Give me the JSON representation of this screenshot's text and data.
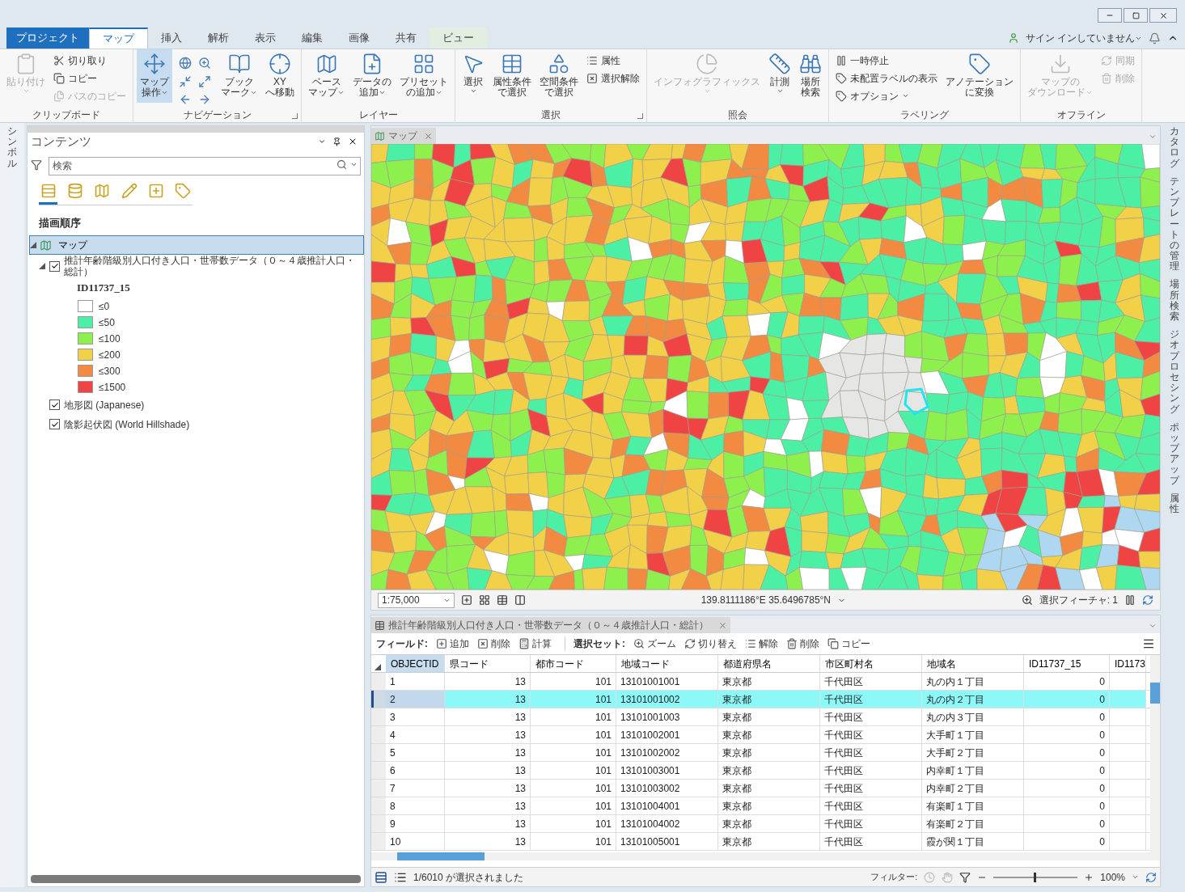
{
  "ribbon_tabs": [
    {
      "label": "プロジェクト",
      "kind": "file",
      "selected": false
    },
    {
      "label": "マップ",
      "kind": "normal",
      "selected": true
    },
    {
      "label": "挿入",
      "kind": "normal",
      "selected": false
    },
    {
      "label": "解析",
      "kind": "normal",
      "selected": false
    },
    {
      "label": "表示",
      "kind": "normal",
      "selected": false
    },
    {
      "label": "編集",
      "kind": "normal",
      "selected": false
    },
    {
      "label": "画像",
      "kind": "normal",
      "selected": false
    },
    {
      "label": "共有",
      "kind": "normal",
      "selected": false
    },
    {
      "label": "ビュー",
      "kind": "contextual",
      "selected": false
    }
  ],
  "account": {
    "label": "サイン インしていません"
  },
  "ribbon_groups": [
    {
      "title": "クリップボード",
      "launcher": false,
      "items": [
        {
          "kind": "large",
          "lines": [
            "貼り付け"
          ],
          "disabled": true,
          "menu": true
        },
        {
          "kind": "stack",
          "entries": [
            {
              "label": "切り取り",
              "disabled": false,
              "menu": false
            },
            {
              "label": "コピー",
              "disabled": false,
              "menu": false
            },
            {
              "label": "パスのコピー",
              "disabled": true,
              "menu": false
            }
          ]
        }
      ]
    },
    {
      "title": "ナビゲーション",
      "launcher": true,
      "items": [
        {
          "kind": "large",
          "lines": [
            "マップ",
            "操作"
          ],
          "disabled": false,
          "menu": true,
          "selected": true
        },
        {
          "kind": "icongrid"
        },
        {
          "kind": "large",
          "lines": [
            "ブック",
            "マーク"
          ],
          "disabled": false,
          "menu": true
        },
        {
          "kind": "large",
          "lines": [
            "XY",
            "へ移動"
          ],
          "disabled": false,
          "menu": false
        }
      ]
    },
    {
      "title": "レイヤー",
      "launcher": false,
      "items": [
        {
          "kind": "large",
          "lines": [
            "ベース",
            "マップ"
          ],
          "disabled": false,
          "menu": true
        },
        {
          "kind": "large",
          "lines": [
            "データの",
            "追加"
          ],
          "disabled": false,
          "menu": true
        },
        {
          "kind": "large",
          "lines": [
            "プリセット",
            "の追加"
          ],
          "disabled": false,
          "menu": true
        }
      ]
    },
    {
      "title": "選択",
      "launcher": true,
      "items": [
        {
          "kind": "large",
          "lines": [
            "選択"
          ],
          "disabled": false,
          "menu": true
        },
        {
          "kind": "large",
          "lines": [
            "属性条件",
            "で選択"
          ],
          "disabled": false,
          "menu": false
        },
        {
          "kind": "large",
          "lines": [
            "空間条件",
            "で選択"
          ],
          "disabled": false,
          "menu": false
        },
        {
          "kind": "stack",
          "entries": [
            {
              "label": "属性",
              "disabled": false,
              "menu": false
            },
            {
              "label": "選択解除",
              "disabled": false,
              "menu": false
            }
          ]
        }
      ]
    },
    {
      "title": "照会",
      "launcher": false,
      "items": [
        {
          "kind": "large",
          "lines": [
            "インフォグラフィックス"
          ],
          "disabled": true,
          "menu": true
        },
        {
          "kind": "large",
          "lines": [
            "計測"
          ],
          "disabled": false,
          "menu": true
        },
        {
          "kind": "large",
          "lines": [
            "場所",
            "検索"
          ],
          "disabled": false,
          "menu": false
        }
      ]
    },
    {
      "title": "ラベリング",
      "launcher": false,
      "items": [
        {
          "kind": "stack",
          "entries": [
            {
              "label": "一時停止",
              "disabled": false,
              "menu": false
            },
            {
              "label": "未配置ラベルの表示",
              "disabled": false,
              "menu": false
            },
            {
              "label": "オプション",
              "disabled": false,
              "menu": true
            }
          ]
        },
        {
          "kind": "large",
          "lines": [
            "アノテーション",
            "に変換"
          ],
          "disabled": false,
          "menu": false
        }
      ]
    },
    {
      "title": "オフライン",
      "launcher": false,
      "items": [
        {
          "kind": "large",
          "lines": [
            "マップの",
            "ダウンロード"
          ],
          "disabled": true,
          "menu": true
        },
        {
          "kind": "stack",
          "entries": [
            {
              "label": "同期",
              "disabled": true,
              "menu": false
            },
            {
              "label": "削除",
              "disabled": true,
              "menu": false
            }
          ]
        }
      ]
    }
  ],
  "left_dock": [
    {
      "label": "シンボル"
    }
  ],
  "right_dock": [
    {
      "label": "カタログ"
    },
    {
      "label": "テンプレートの管理"
    },
    {
      "label": "場所検索"
    },
    {
      "label": "ジオプロセシング"
    },
    {
      "label": "ポップアップ"
    },
    {
      "label": "属性"
    }
  ],
  "contents": {
    "title": "コンテンツ",
    "search": {
      "placeholder": "検索"
    },
    "view_tabs": [
      {
        "selected": true
      },
      {
        "selected": false
      },
      {
        "selected": false
      },
      {
        "selected": false
      },
      {
        "selected": false
      },
      {
        "selected": false
      }
    ],
    "heading": "描画順序",
    "tree": [
      {
        "label": "マップ",
        "selected": true,
        "expanded": true,
        "children": [
          {
            "label": "推計年齢階級別人口付き人口・世帯数データ（０～４歳推計人口・総計）",
            "checked": true,
            "expanded": true,
            "legend": {
              "field": "ID11737_15",
              "classes": [
                {
                  "label": "≤0",
                  "color": "#ffffff"
                },
                {
                  "label": "≤50",
                  "color": "#4cf0a4"
                },
                {
                  "label": "≤100",
                  "color": "#8ef04c"
                },
                {
                  "label": "≤200",
                  "color": "#f2d048"
                },
                {
                  "label": "≤300",
                  "color": "#f28a42"
                },
                {
                  "label": "≤1500",
                  "color": "#f04444"
                }
              ]
            }
          },
          {
            "label": "地形図 (Japanese)",
            "checked": true
          },
          {
            "label": "陰影起伏図 (World Hillshade)",
            "checked": true
          }
        ]
      }
    ]
  },
  "map_view": {
    "tab": {
      "label": "マップ",
      "selected": true
    },
    "scale": "1:75,000",
    "coordinates": "139.8111186°E 35.6496785°N",
    "selected_features": "選択フィーチャ: 1"
  },
  "table_view": {
    "tab": {
      "label": "推計年齢階級別人口付き人口・世帯数データ（０～４歳推計人口・総計）"
    },
    "toolbar": [
      {
        "kind": "heading",
        "label": "フィールド:"
      },
      {
        "kind": "button",
        "label": "追加"
      },
      {
        "kind": "button",
        "label": "削除"
      },
      {
        "kind": "button",
        "label": "計算"
      },
      {
        "kind": "heading",
        "label": "選択セット:"
      },
      {
        "kind": "button",
        "label": "ズーム"
      },
      {
        "kind": "button",
        "label": "切り替え"
      },
      {
        "kind": "button",
        "label": "解除"
      },
      {
        "kind": "button",
        "label": "削除"
      },
      {
        "kind": "button",
        "label": "コピー"
      }
    ],
    "columns": [
      {
        "label": "OBJECTID",
        "kind": "text",
        "selected": true
      },
      {
        "label": "県コード",
        "kind": "number",
        "selected": false
      },
      {
        "label": "都市コード",
        "kind": "number",
        "selected": false
      },
      {
        "label": "地域コード",
        "kind": "text",
        "selected": false
      },
      {
        "label": "都道府県名",
        "kind": "text",
        "selected": false
      },
      {
        "label": "市区町村名",
        "kind": "text",
        "selected": false
      },
      {
        "label": "地域名",
        "kind": "text",
        "selected": false
      },
      {
        "label": "ID11737_15",
        "kind": "number",
        "selected": false
      },
      {
        "label": "ID1173",
        "kind": "number",
        "selected": false
      }
    ],
    "rows": [
      {
        "selected": false,
        "cells": [
          "1",
          "13",
          "101",
          "13101001001",
          "東京都",
          "千代田区",
          "丸の内１丁目",
          "0"
        ]
      },
      {
        "selected": true,
        "cells": [
          "2",
          "13",
          "101",
          "13101001002",
          "東京都",
          "千代田区",
          "丸の内２丁目",
          "0"
        ]
      },
      {
        "selected": false,
        "cells": [
          "3",
          "13",
          "101",
          "13101001003",
          "東京都",
          "千代田区",
          "丸の内３丁目",
          "0"
        ]
      },
      {
        "selected": false,
        "cells": [
          "4",
          "13",
          "101",
          "13101002001",
          "東京都",
          "千代田区",
          "大手町１丁目",
          "0"
        ]
      },
      {
        "selected": false,
        "cells": [
          "5",
          "13",
          "101",
          "13101002002",
          "東京都",
          "千代田区",
          "大手町２丁目",
          "0"
        ]
      },
      {
        "selected": false,
        "cells": [
          "6",
          "13",
          "101",
          "13101003001",
          "東京都",
          "千代田区",
          "内幸町１丁目",
          "0"
        ]
      },
      {
        "selected": false,
        "cells": [
          "7",
          "13",
          "101",
          "13101003002",
          "東京都",
          "千代田区",
          "内幸町２丁目",
          "0"
        ]
      },
      {
        "selected": false,
        "cells": [
          "8",
          "13",
          "101",
          "13101004001",
          "東京都",
          "千代田区",
          "有楽町１丁目",
          "0"
        ]
      },
      {
        "selected": false,
        "cells": [
          "9",
          "13",
          "101",
          "13101004002",
          "東京都",
          "千代田区",
          "有楽町２丁目",
          "0"
        ]
      },
      {
        "selected": false,
        "cells": [
          "10",
          "13",
          "101",
          "13101005001",
          "東京都",
          "千代田区",
          "霞が関１丁目",
          "0"
        ]
      }
    ],
    "status": "1/6010 が選択されました",
    "filter_label": "フィルター:",
    "zoom": {
      "level": 0.48,
      "reading": "100%"
    }
  }
}
